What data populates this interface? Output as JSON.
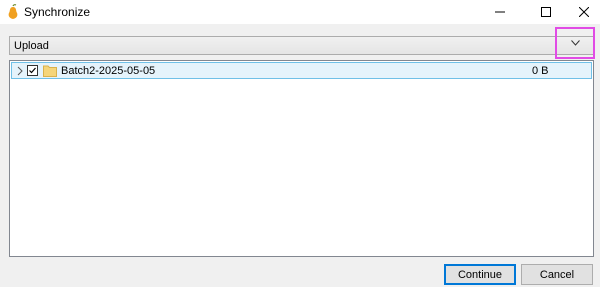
{
  "window": {
    "title": "Synchronize",
    "app_icon": "pear-icon",
    "controls": [
      "minimize-icon",
      "maximize-icon",
      "close-icon"
    ]
  },
  "direction_select": {
    "selected": "Upload",
    "icon": "chevron-down-icon"
  },
  "tree": {
    "rows": [
      {
        "name": "Batch2-2025-05-05",
        "size": "0 B",
        "checked": true,
        "icon": "folder-icon"
      }
    ]
  },
  "buttons": {
    "continue": "Continue",
    "cancel": "Cancel"
  },
  "colors": {
    "accent": "#0078d7",
    "highlight_outline": "#e14be5",
    "row_selected_bg": "#e5f3fb",
    "folder": "#f5d57a"
  }
}
